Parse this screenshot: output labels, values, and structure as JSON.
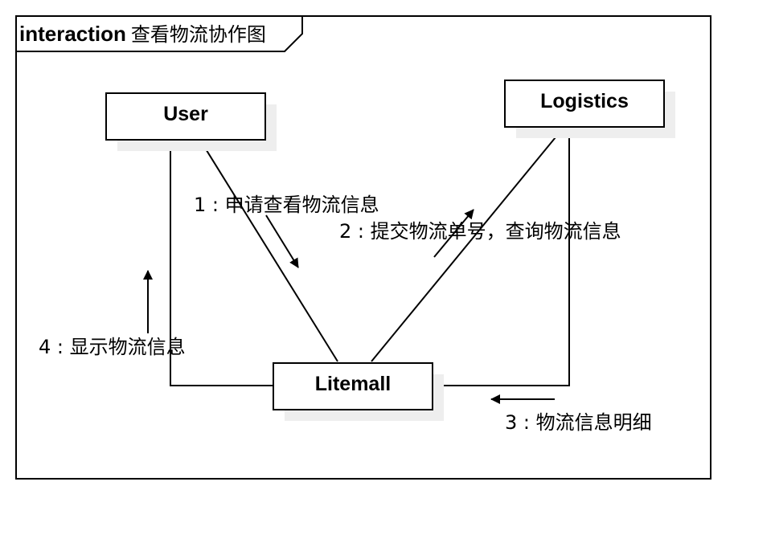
{
  "frame": {
    "keyword": "interaction",
    "name": "查看物流协作图"
  },
  "objects": {
    "user": "User",
    "logistics": "Logistics",
    "litemall": "Litemall"
  },
  "messages": {
    "m1": "1 : 申请查看物流信息",
    "m2": "2 : 提交物流单号，查询物流信息",
    "m3": "3 : 物流信息明细",
    "m4": "4 : 显示物流信息"
  },
  "colors": {
    "line": "#000000",
    "shadow": "#eeeeee",
    "background": "#ffffff"
  }
}
